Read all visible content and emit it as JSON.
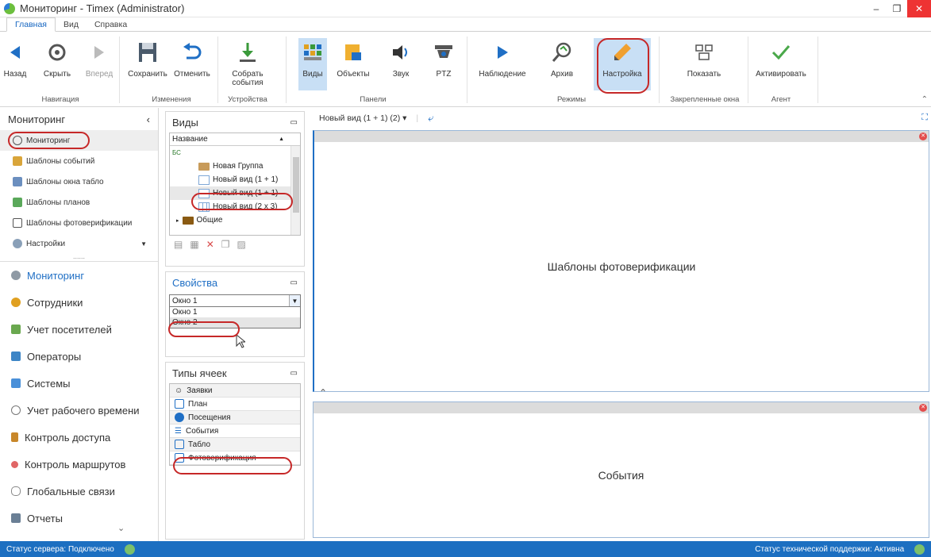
{
  "window": {
    "title": "Мониторинг - Timex (Administrator)"
  },
  "menu": {
    "tabs": [
      "Главная",
      "Вид",
      "Справка"
    ]
  },
  "ribbon": {
    "nav": {
      "back": "Назад",
      "hide": "Скрыть",
      "forward": "Вперед",
      "group": "Навигация"
    },
    "changes": {
      "save": "Сохранить",
      "undo": "Отменить",
      "group": "Изменения"
    },
    "devices": {
      "collect": "Собрать события",
      "group": "Устройства"
    },
    "panels": {
      "views": "Виды",
      "objects": "Объекты",
      "sound": "Звук",
      "ptz": "PTZ",
      "group": "Панели"
    },
    "modes": {
      "observe": "Наблюдение",
      "archive": "Архив",
      "setup": "Настройка",
      "group": "Режимы"
    },
    "pinned": {
      "show": "Показать",
      "group": "Закрепленные окна"
    },
    "agent": {
      "activate": "Активировать",
      "group": "Агент"
    }
  },
  "leftnav": {
    "header": "Мониторинг",
    "subitems": [
      "Мониторинг",
      "Шаблоны событий",
      "Шаблоны окна табло",
      "Шаблоны планов",
      "Шаблоны фотоверификации",
      "Настройки"
    ],
    "dots": "......",
    "items": [
      "Мониторинг",
      "Сотрудники",
      "Учет посетителей",
      "Операторы",
      "Системы",
      "Учет рабочего времени",
      "Контроль доступа",
      "Контроль маршрутов",
      "Глобальные связи",
      "Отчеты"
    ]
  },
  "views_panel": {
    "title": "Виды",
    "column": "Название",
    "filter": "БС",
    "rows": [
      "Новая Группа",
      "Новый вид (1 + 1)",
      "Новый вид (1 + 1)",
      "Новый вид (2 x 3)",
      "Общие"
    ]
  },
  "props_panel": {
    "title": "Свойства",
    "selected": "Окно 1",
    "options": [
      "Окно 1",
      "Окно 2"
    ]
  },
  "celltypes_panel": {
    "title": "Типы ячеек",
    "rows": [
      "Заявки",
      "План",
      "Посещения",
      "События",
      "Табло",
      "Фотоверификация"
    ]
  },
  "main": {
    "tab": "Новый вид (1 + 1) (2) ▾",
    "top_cell": "Шаблоны фотоверификации",
    "bottom_cell": "События"
  },
  "status": {
    "left": "Статус сервера: Подключено",
    "right": "Статус технической поддержки: Активна"
  },
  "colors": {
    "accent": "#1f6fc5",
    "statusbar": "#1c6fc1",
    "highlight_ring": "#c62828"
  }
}
